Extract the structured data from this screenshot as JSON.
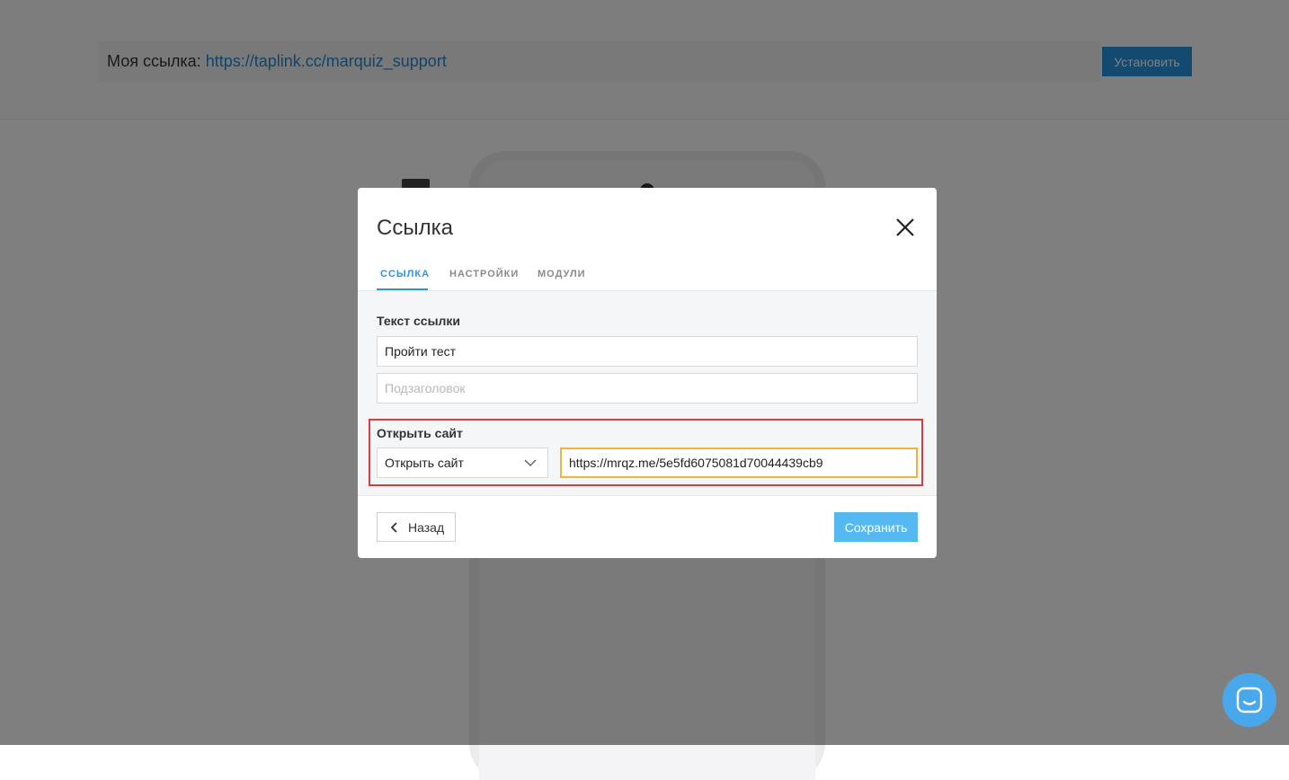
{
  "header": {
    "my_link_label": "Моя ссылка:",
    "my_link_url": "https://taplink.cc/marquiz_support",
    "install_label": "Установить"
  },
  "modal": {
    "title": "Ссылка",
    "tabs": [
      {
        "label": "ССЫЛКА",
        "active": true
      },
      {
        "label": "НАСТРОЙКИ",
        "active": false
      },
      {
        "label": "МОДУЛИ",
        "active": false
      }
    ],
    "link_text_label": "Текст ссылки",
    "link_text_value": "Пройти тест",
    "subtitle_placeholder": "Подзаголовок",
    "open_site_label": "Открыть сайт",
    "action_select_value": "Открыть сайт",
    "url_value": "https://mrqz.me/5e5fd6075081d70044439cb9",
    "back_label": "Назад",
    "save_label": "Сохранить"
  },
  "colors": {
    "accent": "#2a95e0",
    "save_button": "#55b8f0",
    "highlight_border": "#e0393e",
    "focus_border": "#f2b33d"
  },
  "icons": {
    "close": "close-icon",
    "chevron_down": "chevron-down-icon",
    "back": "chevron-left-icon",
    "chat": "chat-icon"
  }
}
